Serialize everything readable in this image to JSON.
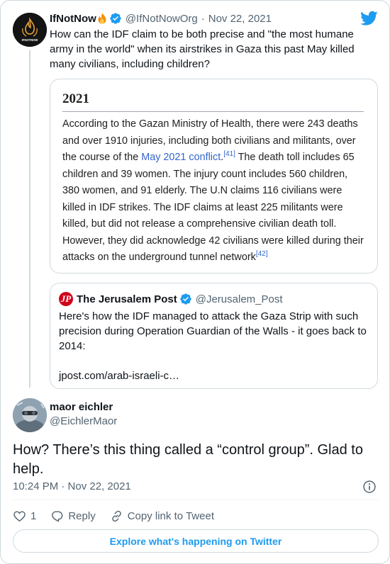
{
  "parent_tweet": {
    "author_name": "IfNotNow",
    "handle": "@IfNotNowOrg",
    "separator": "·",
    "date": "Nov 22, 2021",
    "text": "How can the IDF claim to be both precise and \"the most humane army in the world\" when its airstrikes in Gaza this past May killed many civilians, including children?",
    "avatar_label": "IFNOTNOW"
  },
  "media_card": {
    "heading": "2021",
    "body_part1": "According to the Gazan Ministry of Health, there were 243 deaths and over 1910 injuries, including both civilians and militants, over the course of the ",
    "link_text": "May 2021 conflict",
    "ref1": "[41]",
    "body_part2": " The death toll includes 65 children and 39 women. The injury count includes 560 children, 380 women, and 91 elderly. The U.N claims 116 civilians were killed in IDF strikes. The IDF claims at least 225 militants were killed, but did not release a comprehensive civilian death toll. However, they did acknowledge 42 civilians were killed during their attacks on the underground tunnel network",
    "ref2": "[42]"
  },
  "quoted_tweet": {
    "avatar_letter": "JP",
    "author_name": "The Jerusalem Post",
    "handle": "@Jerusalem_Post",
    "text": "Here's how the IDF managed to attack the Gaza Strip with such precision during Operation Guardian of the Walls - it goes back to 2014:",
    "link": "jpost.com/arab-israeli-c…"
  },
  "main_tweet": {
    "author_name": "maor eichler",
    "handle": "@EichlerMaor",
    "text": "How? There’s this thing called a “control group”. Glad to help.",
    "timestamp": "10:24 PM · Nov 22, 2021"
  },
  "actions": {
    "like_count": "1",
    "reply_label": "Reply",
    "copy_link_label": "Copy link to Tweet"
  },
  "footer": {
    "explore_label": "Explore what's happening on Twitter"
  },
  "colors": {
    "twitter_blue": "#1d9bf0",
    "link_blue": "#3366cc",
    "text_primary": "#0f1419",
    "text_secondary": "#536471",
    "border": "#cfd9de",
    "jpost_red": "#d0021b"
  },
  "icons": [
    "twitter-bird-icon",
    "verified-badge-icon",
    "fire-emoji-icon",
    "info-icon",
    "heart-icon",
    "reply-bubble-icon",
    "link-icon"
  ]
}
